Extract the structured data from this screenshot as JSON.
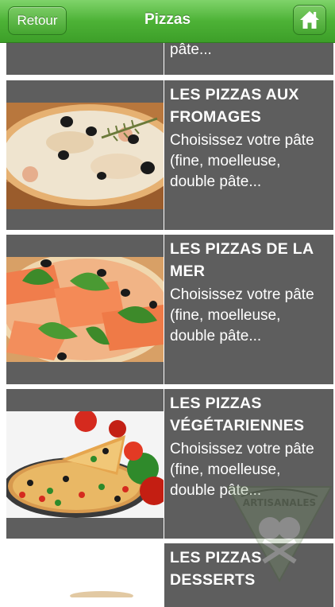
{
  "navbar": {
    "title": "Pizzas",
    "back_label": "Retour",
    "home_icon": "home-icon"
  },
  "colors": {
    "navbar_green": "#4db236",
    "row_gray": "#5e5e5e",
    "text_white": "#ffffff"
  },
  "items": [
    {
      "title": "",
      "description": "pâte..."
    },
    {
      "title": "LES PIZZAS AUX FROMAGES",
      "description": "Choisissez votre pâte (fine, moelleuse, double pâte..."
    },
    {
      "title": "LES PIZZAS DE LA MER",
      "description": "Choisissez votre pâte (fine, moelleuse, double pâte..."
    },
    {
      "title": "LES PIZZAS VÉGÉTARIENNES",
      "description": "Choisissez votre pâte (fine, moelleuse, double pâte..."
    },
    {
      "title": "LES PIZZAS DESSERTS",
      "description": ""
    }
  ],
  "watermark": {
    "text": "ARTISANALES"
  }
}
